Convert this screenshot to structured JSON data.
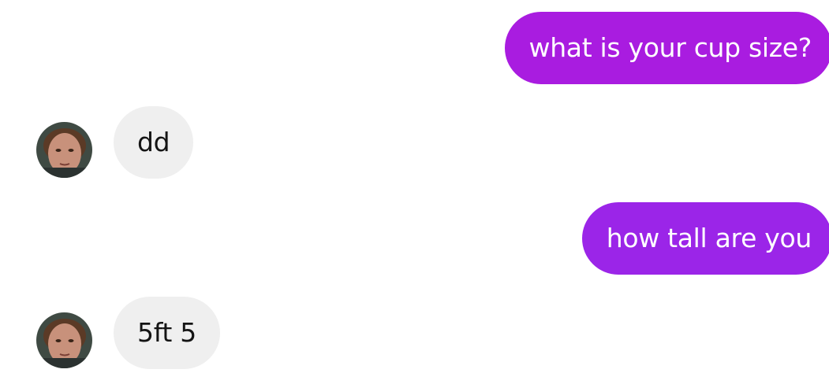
{
  "messages": [
    {
      "sender": "me",
      "text": "what is your cup size?",
      "color": "#a91ce0"
    },
    {
      "sender": "them",
      "text": "dd",
      "avatar_icon": "user-avatar"
    },
    {
      "sender": "me",
      "text": "how tall are you",
      "color": "#9b25e8"
    },
    {
      "sender": "them",
      "text": "5ft 5",
      "avatar_icon": "user-avatar"
    }
  ],
  "colors": {
    "outgoing_bubble_1": "#a91ce0",
    "outgoing_bubble_2": "#9b25e8",
    "incoming_bubble": "#efefef",
    "outgoing_text": "#ffffff",
    "incoming_text": "#141414",
    "background": "#ffffff"
  }
}
